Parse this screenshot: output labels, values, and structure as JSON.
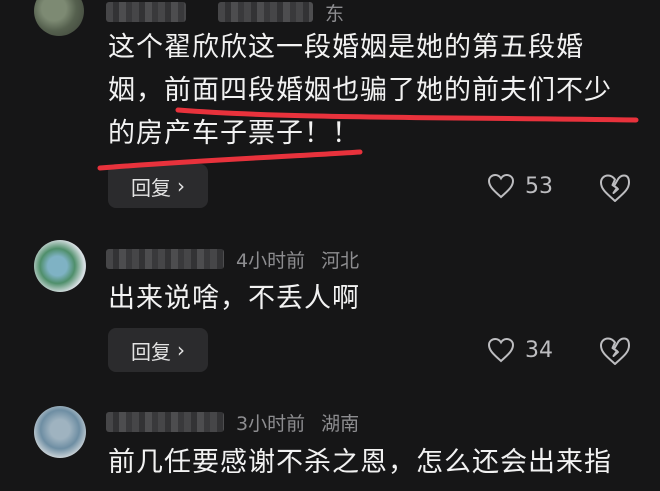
{
  "comments": [
    {
      "name_top_fragment": "东",
      "content_lines": [
        "这个翟欣欣这一段婚姻是她的第五段婚",
        "姻，前面四段婚姻也骗了她的前夫们不少",
        "的房产车子票子！！"
      ],
      "reply_label": "回复",
      "likes": "53"
    },
    {
      "time": "4小时前",
      "location": "河北",
      "content_lines": [
        "出来说啥，不丢人啊"
      ],
      "reply_label": "回复",
      "likes": "34"
    },
    {
      "time": "3小时前",
      "location": "湖南",
      "content_lines": [
        "前几任要感谢不杀之恩，怎么还会出来指"
      ]
    }
  ],
  "icons": {
    "like": "heart-outline-icon",
    "dislike": "broken-heart-icon",
    "reply_arrow": "chevron-right-icon"
  },
  "colors": {
    "background": "#161617",
    "highlight_stroke": "#e8323c",
    "meta_text": "#8d8d90",
    "reply_bg": "#2b2b2d"
  }
}
